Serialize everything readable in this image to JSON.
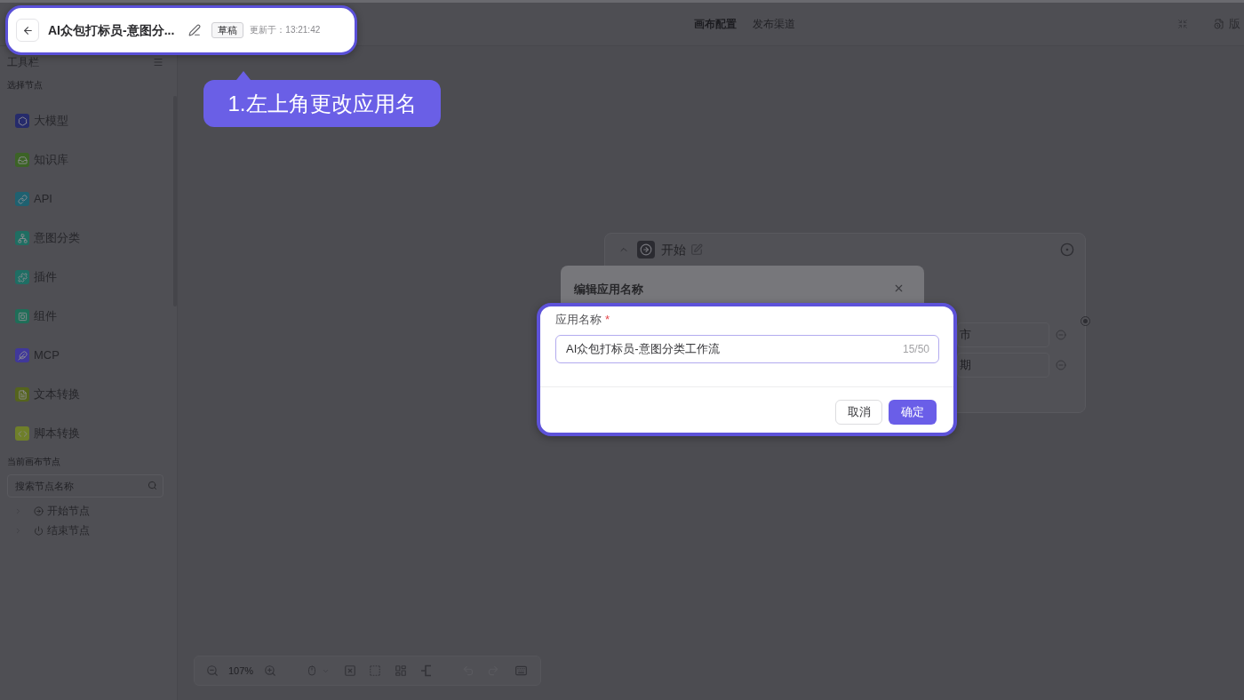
{
  "header": {
    "title": "AI众包打标员-意图分...",
    "status": "草稿",
    "updated": "更新于：13:21:42"
  },
  "callout": {
    "text": "1.左上角更改应用名"
  },
  "top_tabs": [
    {
      "label": "画布配置",
      "selected": true
    },
    {
      "label": "发布渠道",
      "selected": false
    }
  ],
  "version_button": {
    "label": "版"
  },
  "sidebar": {
    "title": "工具栏",
    "section": "选择节点",
    "tools": [
      {
        "label": "大模型",
        "color": "#262b6b"
      },
      {
        "label": "知识库",
        "color": "#3c6326"
      },
      {
        "label": "API",
        "color": "#1f6170"
      },
      {
        "label": "意图分类",
        "color": "#1f6e62"
      },
      {
        "label": "插件",
        "color": "#1f6e64"
      },
      {
        "label": "组件",
        "color": "#1f6e58"
      },
      {
        "label": "MCP",
        "color": "#40389a"
      },
      {
        "label": "文本转换",
        "color": "#55641d"
      },
      {
        "label": "脚本转换",
        "color": "#6f7f2a"
      }
    ],
    "canvas_section": "当前画布节点",
    "search": {
      "placeholder": "搜索节点名称"
    },
    "tree": [
      {
        "label": "开始节点",
        "expanded": false
      },
      {
        "label": "结束节点",
        "expanded": false
      }
    ]
  },
  "start_node": {
    "title": "开始",
    "fields": [
      {
        "value": "市"
      },
      {
        "value": "期"
      }
    ]
  },
  "dialog": {
    "title": "编辑应用名称",
    "field": {
      "label": "应用名称",
      "required_mark": "*",
      "value": "AI众包打标员-意图分类工作流",
      "counter": "15/50"
    },
    "buttons": [
      {
        "label": "取消",
        "kind": "default"
      },
      {
        "label": "确定",
        "kind": "primary"
      }
    ]
  },
  "toolbar": {
    "zoom": "107%",
    "undo": {
      "disabled": true
    },
    "redo": {
      "disabled": true
    }
  }
}
